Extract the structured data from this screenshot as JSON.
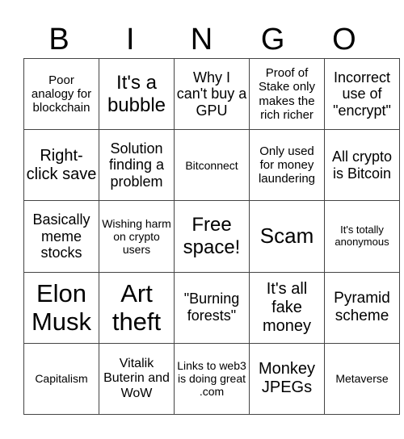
{
  "header": {
    "letters": [
      "B",
      "I",
      "N",
      "G",
      "O"
    ]
  },
  "grid": {
    "rows": [
      [
        "Poor analogy for blockchain",
        "It's a bubble",
        "Why I can't buy a GPU",
        "Proof of Stake only makes the rich richer",
        "Incorrect use of \"encrypt\""
      ],
      [
        "Right-click save",
        "Solution finding a problem",
        "Bitconnect",
        "Only used for money laundering",
        "All crypto is Bitcoin"
      ],
      [
        "Basically meme stocks",
        "Wishing harm on crypto users",
        "Free space!",
        "Scam",
        "It's totally anonymous"
      ],
      [
        "Elon Musk",
        "Art theft",
        "\"Burning forests\"",
        "It's all fake money",
        "Pyramid scheme"
      ],
      [
        "Capitalism",
        "Vitalik Buterin and WoW",
        "Links to web3 is doing great .com",
        "Monkey JPEGs",
        "Metaverse"
      ]
    ]
  }
}
